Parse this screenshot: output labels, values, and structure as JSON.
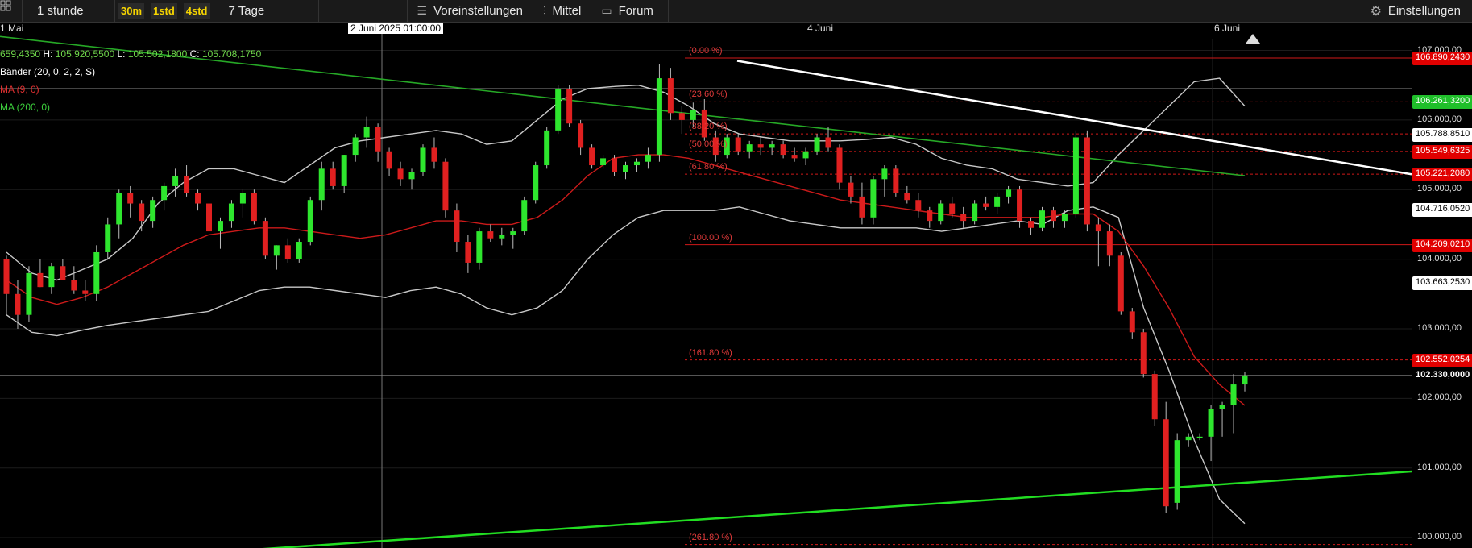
{
  "toolbar": {
    "interval": "1 stunde",
    "quick_ranges": [
      "30m",
      "1std",
      "4std"
    ],
    "range": "7 Tage",
    "presets": "Voreinstellungen",
    "indicators": "Mittel",
    "forum": "Forum",
    "settings": "Einstellungen"
  },
  "dates": {
    "d1": "1 Mai",
    "crosshair": "2 Juni 2025 01:00:00",
    "d2": "4 Juni",
    "d3": "6 Juni"
  },
  "ohlc": {
    "o_value": "659,4350",
    "h_label": "H:",
    "h_value": "105.920,5500",
    "l_label": "L:",
    "l_value": "105.502,1800",
    "c_label": "C:",
    "c_value": "105.708,1750"
  },
  "legend": {
    "bollinger": "Bänder (20, 0, 2, 2, S)",
    "ma9": "MA (9, 0)",
    "ma200": "MA (200, 0)"
  },
  "fib_levels": [
    "(0.00 %)",
    "(23.60 %)",
    "(38.20 %)",
    "(50.00 %)",
    "(61.80 %)",
    "(100.00 %)",
    "(161.80 %)",
    "(261.80 %)"
  ],
  "axis_ticks": [
    "107.000,00",
    "106.000,00",
    "105.000,00",
    "104.000,00",
    "103.000,00",
    "102.000,00",
    "101.000,00",
    "100.000,00"
  ],
  "axis_tags": {
    "fib0": "106.890,2430",
    "fib236": "106.261,3200",
    "bb_upper": "105.788,8510",
    "fib382": "105.549,6325",
    "fib50": "105.221,2080",
    "bb_mid": "104.716,0520",
    "fib100": "104.209,0210",
    "bb_lower": "103.663,2530",
    "fib1618": "102.552,0254",
    "current": "102.330,0000"
  },
  "colors": {
    "up": "#2ee62e",
    "down": "#e02020",
    "fib": "#d01818",
    "ma9": "#cc1a1a",
    "ma200": "#26a826",
    "bands": "#c8c8c8",
    "trend_white": "#ffffff",
    "trend_green": "#22dd22"
  },
  "chart_data": {
    "type": "candlestick",
    "y_range": [
      99.85,
      107.4
    ],
    "fib_values": [
      106.89,
      106.261,
      105.8,
      105.549,
      105.221,
      104.209,
      102.552,
      99.9
    ],
    "candles": [
      [
        104.0,
        104.05,
        103.2,
        103.5
      ],
      [
        103.5,
        103.7,
        103.0,
        103.2
      ],
      [
        103.2,
        103.9,
        103.1,
        103.8
      ],
      [
        103.8,
        104.0,
        103.6,
        103.6
      ],
      [
        103.6,
        103.95,
        103.5,
        103.9
      ],
      [
        103.9,
        104.0,
        103.7,
        103.7
      ],
      [
        103.7,
        103.9,
        103.5,
        103.55
      ],
      [
        103.55,
        103.7,
        103.4,
        103.5
      ],
      [
        103.5,
        104.2,
        103.4,
        104.1
      ],
      [
        104.1,
        104.6,
        104.0,
        104.5
      ],
      [
        104.5,
        105.0,
        104.3,
        104.95
      ],
      [
        104.95,
        105.05,
        104.6,
        104.8
      ],
      [
        104.8,
        104.85,
        104.4,
        104.55
      ],
      [
        104.55,
        104.9,
        104.45,
        104.85
      ],
      [
        104.85,
        105.1,
        104.7,
        105.05
      ],
      [
        105.05,
        105.3,
        104.9,
        105.2
      ],
      [
        105.2,
        105.35,
        104.9,
        104.95
      ],
      [
        104.95,
        105.0,
        104.7,
        104.8
      ],
      [
        104.8,
        104.95,
        104.25,
        104.4
      ],
      [
        104.4,
        104.6,
        104.15,
        104.55
      ],
      [
        104.55,
        104.85,
        104.45,
        104.8
      ],
      [
        104.8,
        105.0,
        104.6,
        104.95
      ],
      [
        104.95,
        105.0,
        104.5,
        104.55
      ],
      [
        104.55,
        104.6,
        104.0,
        104.05
      ],
      [
        104.05,
        104.2,
        103.85,
        104.2
      ],
      [
        104.2,
        104.3,
        103.95,
        104.0
      ],
      [
        104.0,
        104.3,
        103.95,
        104.25
      ],
      [
        104.25,
        104.9,
        104.2,
        104.85
      ],
      [
        104.85,
        105.4,
        104.7,
        105.3
      ],
      [
        105.3,
        105.4,
        105.0,
        105.05
      ],
      [
        105.05,
        105.5,
        104.95,
        105.5
      ],
      [
        105.5,
        105.8,
        105.4,
        105.75
      ],
      [
        105.75,
        106.05,
        105.6,
        105.9
      ],
      [
        105.9,
        105.95,
        105.4,
        105.55
      ],
      [
        105.55,
        105.6,
        105.2,
        105.3
      ],
      [
        105.3,
        105.4,
        105.05,
        105.15
      ],
      [
        105.15,
        105.3,
        105.0,
        105.25
      ],
      [
        105.25,
        105.65,
        105.2,
        105.6
      ],
      [
        105.6,
        105.75,
        105.3,
        105.4
      ],
      [
        105.4,
        105.45,
        104.6,
        104.7
      ],
      [
        104.7,
        104.8,
        104.1,
        104.25
      ],
      [
        104.25,
        104.35,
        103.8,
        103.95
      ],
      [
        103.95,
        104.45,
        103.85,
        104.4
      ],
      [
        104.4,
        104.5,
        104.25,
        104.3
      ],
      [
        104.3,
        104.45,
        104.2,
        104.35
      ],
      [
        104.35,
        104.45,
        104.15,
        104.4
      ],
      [
        104.4,
        104.9,
        104.35,
        104.85
      ],
      [
        104.85,
        105.4,
        104.8,
        105.35
      ],
      [
        105.35,
        105.9,
        105.3,
        105.85
      ],
      [
        105.85,
        106.5,
        105.8,
        106.45
      ],
      [
        106.45,
        106.5,
        105.9,
        105.95
      ],
      [
        105.95,
        106.0,
        105.5,
        105.6
      ],
      [
        105.6,
        105.65,
        105.3,
        105.35
      ],
      [
        105.35,
        105.5,
        105.3,
        105.45
      ],
      [
        105.45,
        105.5,
        105.2,
        105.25
      ],
      [
        105.25,
        105.4,
        105.15,
        105.35
      ],
      [
        105.35,
        105.45,
        105.25,
        105.4
      ],
      [
        105.4,
        105.6,
        105.3,
        105.5
      ],
      [
        105.5,
        106.8,
        105.4,
        106.6
      ],
      [
        106.6,
        106.75,
        106.0,
        106.1
      ],
      [
        106.1,
        106.2,
        105.8,
        106.0
      ],
      [
        106.0,
        106.25,
        105.9,
        106.15
      ],
      [
        106.15,
        106.3,
        105.7,
        105.75
      ],
      [
        105.75,
        105.85,
        105.4,
        105.5
      ],
      [
        105.5,
        105.8,
        105.45,
        105.75
      ],
      [
        105.75,
        105.8,
        105.5,
        105.55
      ],
      [
        105.55,
        105.7,
        105.45,
        105.65
      ],
      [
        105.65,
        105.75,
        105.5,
        105.6
      ],
      [
        105.6,
        105.7,
        105.5,
        105.65
      ],
      [
        105.65,
        105.7,
        105.45,
        105.5
      ],
      [
        105.5,
        105.6,
        105.4,
        105.45
      ],
      [
        105.45,
        105.6,
        105.35,
        105.55
      ],
      [
        105.55,
        105.8,
        105.5,
        105.75
      ],
      [
        105.75,
        105.9,
        105.55,
        105.6
      ],
      [
        105.6,
        105.65,
        105.0,
        105.1
      ],
      [
        105.1,
        105.2,
        104.8,
        104.9
      ],
      [
        104.9,
        105.1,
        104.5,
        104.6
      ],
      [
        104.6,
        105.2,
        104.5,
        105.15
      ],
      [
        105.15,
        105.35,
        104.9,
        105.3
      ],
      [
        105.3,
        105.35,
        104.9,
        104.95
      ],
      [
        104.95,
        105.05,
        104.8,
        104.85
      ],
      [
        104.85,
        104.95,
        104.6,
        104.7
      ],
      [
        104.7,
        104.75,
        104.45,
        104.55
      ],
      [
        104.55,
        104.85,
        104.5,
        104.8
      ],
      [
        104.8,
        104.9,
        104.6,
        104.65
      ],
      [
        104.65,
        104.75,
        104.45,
        104.55
      ],
      [
        104.55,
        104.85,
        104.5,
        104.8
      ],
      [
        104.8,
        104.9,
        104.7,
        104.75
      ],
      [
        104.75,
        104.95,
        104.65,
        104.9
      ],
      [
        104.9,
        105.05,
        104.8,
        105.0
      ],
      [
        105.0,
        105.05,
        104.45,
        104.55
      ],
      [
        104.55,
        104.6,
        104.35,
        104.45
      ],
      [
        104.45,
        104.75,
        104.4,
        104.7
      ],
      [
        104.7,
        104.75,
        104.45,
        104.55
      ],
      [
        104.55,
        104.7,
        104.45,
        104.65
      ],
      [
        104.65,
        105.85,
        104.6,
        105.75
      ],
      [
        105.75,
        105.85,
        104.4,
        104.5
      ],
      [
        104.5,
        104.6,
        103.9,
        104.4
      ],
      [
        104.4,
        104.5,
        103.9,
        104.05
      ],
      [
        104.05,
        104.1,
        103.2,
        103.25
      ],
      [
        103.25,
        103.3,
        102.85,
        102.95
      ],
      [
        102.95,
        103.0,
        102.3,
        102.35
      ],
      [
        102.35,
        102.4,
        101.6,
        101.7
      ],
      [
        101.7,
        101.95,
        100.35,
        100.45
      ],
      [
        100.5,
        101.5,
        100.4,
        101.4
      ],
      [
        101.4,
        101.5,
        101.3,
        101.45
      ],
      [
        101.45,
        101.5,
        101.4,
        101.45
      ],
      [
        101.45,
        101.9,
        101.1,
        101.85
      ],
      [
        101.85,
        101.95,
        101.45,
        101.9
      ],
      [
        101.9,
        102.35,
        101.5,
        102.2
      ],
      [
        102.2,
        102.38,
        102.1,
        102.33
      ]
    ],
    "bb_upper": [
      104.1,
      103.8,
      103.7,
      103.85,
      104.0,
      104.3,
      104.8,
      105.1,
      105.3,
      105.3,
      105.2,
      105.1,
      105.35,
      105.6,
      105.7,
      105.75,
      105.8,
      105.85,
      105.8,
      105.65,
      105.7,
      106.0,
      106.3,
      106.45,
      106.48,
      106.5,
      106.4,
      106.2,
      105.95,
      105.8,
      105.75,
      105.7,
      105.7,
      105.7,
      105.72,
      105.75,
      105.65,
      105.45,
      105.35,
      105.3,
      105.15,
      105.1,
      105.05,
      105.1,
      105.5,
      105.85,
      106.2,
      106.55,
      106.6,
      106.2
    ],
    "bb_lower": [
      103.2,
      102.95,
      102.9,
      102.98,
      103.05,
      103.1,
      103.15,
      103.2,
      103.25,
      103.4,
      103.55,
      103.6,
      103.6,
      103.55,
      103.5,
      103.45,
      103.55,
      103.6,
      103.5,
      103.3,
      103.2,
      103.3,
      103.55,
      104.0,
      104.35,
      104.6,
      104.7,
      104.7,
      104.7,
      104.75,
      104.65,
      104.55,
      104.5,
      104.45,
      104.45,
      104.45,
      104.45,
      104.4,
      104.45,
      104.5,
      104.55,
      104.5,
      104.7,
      104.75,
      104.6,
      103.3,
      102.4,
      101.4,
      100.55,
      100.2
    ],
    "bb_mid": [
      103.7,
      103.45,
      103.35,
      103.45,
      103.6,
      103.8,
      104.0,
      104.2,
      104.35,
      104.4,
      104.45,
      104.45,
      104.4,
      104.35,
      104.3,
      104.35,
      104.45,
      104.55,
      104.55,
      104.5,
      104.5,
      104.6,
      104.85,
      105.2,
      105.45,
      105.5,
      105.5,
      105.45,
      105.35,
      105.25,
      105.15,
      105.05,
      104.95,
      104.85,
      104.8,
      104.75,
      104.7,
      104.65,
      104.6,
      104.6,
      104.6,
      104.6,
      104.65,
      104.65,
      104.4,
      103.9,
      103.3,
      102.6,
      102.2,
      101.9
    ],
    "ma200_start": 107.2,
    "ma200_end": 105.2,
    "trend_white": [
      [
        106.85,
        0.5
      ],
      [
        105.22,
        1.0
      ]
    ],
    "trend_green": [
      [
        99.8,
        0.0
      ],
      [
        100.95,
        1.0
      ]
    ]
  }
}
